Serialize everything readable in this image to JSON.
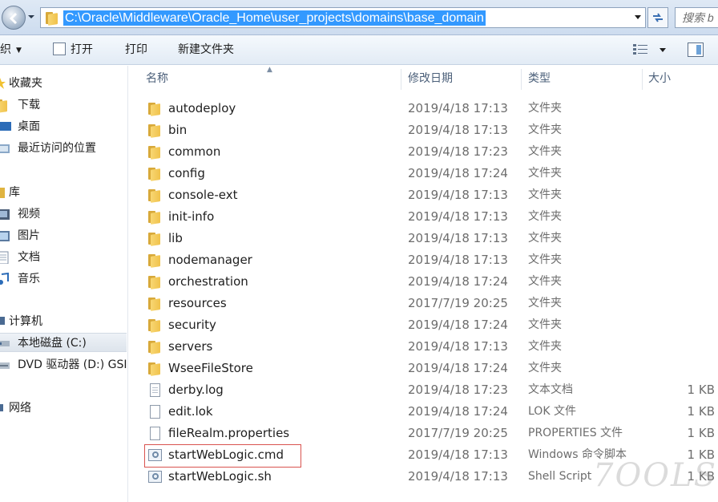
{
  "address_bar": {
    "path": "C:\\Oracle\\Middleware\\Oracle_Home\\user_projects\\domains\\base_domain",
    "search_placeholder": "搜索 b"
  },
  "toolbar": {
    "organize_label": "织",
    "open_label": "打开",
    "print_label": "打印",
    "new_folder_label": "新建文件夹"
  },
  "nav": {
    "favorites": "收藏夹",
    "downloads": "下载",
    "desktop": "桌面",
    "recent": "最近访问的位置",
    "libraries": "库",
    "videos": "视频",
    "pictures": "图片",
    "documents": "文档",
    "music": "音乐",
    "computer": "计算机",
    "local_disk": "本地磁盘 (C:)",
    "dvd": "DVD 驱动器 (D:) GSI",
    "network": "网络"
  },
  "columns": {
    "name": "名称",
    "date": "修改日期",
    "type": "类型",
    "size": "大小"
  },
  "files": [
    {
      "name": "autodeploy",
      "date": "2019/4/18 17:13",
      "type": "文件夹",
      "size": "",
      "icon": "folder-icon"
    },
    {
      "name": "bin",
      "date": "2019/4/18 17:13",
      "type": "文件夹",
      "size": "",
      "icon": "folder-icon"
    },
    {
      "name": "common",
      "date": "2019/4/18 17:23",
      "type": "文件夹",
      "size": "",
      "icon": "folder-icon"
    },
    {
      "name": "config",
      "date": "2019/4/18 17:24",
      "type": "文件夹",
      "size": "",
      "icon": "folder-icon"
    },
    {
      "name": "console-ext",
      "date": "2019/4/18 17:13",
      "type": "文件夹",
      "size": "",
      "icon": "folder-icon"
    },
    {
      "name": "init-info",
      "date": "2019/4/18 17:13",
      "type": "文件夹",
      "size": "",
      "icon": "folder-icon"
    },
    {
      "name": "lib",
      "date": "2019/4/18 17:13",
      "type": "文件夹",
      "size": "",
      "icon": "folder-icon"
    },
    {
      "name": "nodemanager",
      "date": "2019/4/18 17:13",
      "type": "文件夹",
      "size": "",
      "icon": "folder-icon"
    },
    {
      "name": "orchestration",
      "date": "2019/4/18 17:24",
      "type": "文件夹",
      "size": "",
      "icon": "folder-icon"
    },
    {
      "name": "resources",
      "date": "2017/7/19 20:25",
      "type": "文件夹",
      "size": "",
      "icon": "folder-icon"
    },
    {
      "name": "security",
      "date": "2019/4/18 17:24",
      "type": "文件夹",
      "size": "",
      "icon": "folder-icon"
    },
    {
      "name": "servers",
      "date": "2019/4/18 17:13",
      "type": "文件夹",
      "size": "",
      "icon": "folder-icon"
    },
    {
      "name": "WseeFileStore",
      "date": "2019/4/18 17:24",
      "type": "文件夹",
      "size": "",
      "icon": "folder-icon"
    },
    {
      "name": "derby.log",
      "date": "2019/4/18 17:23",
      "type": "文本文档",
      "size": "1 KB",
      "icon": "text-file-icon"
    },
    {
      "name": "edit.lok",
      "date": "2019/4/18 17:24",
      "type": "LOK 文件",
      "size": "1 KB",
      "icon": "file-icon"
    },
    {
      "name": "fileRealm.properties",
      "date": "2017/7/19 20:25",
      "type": "PROPERTIES 文件",
      "size": "1 KB",
      "icon": "file-icon"
    },
    {
      "name": "startWebLogic.cmd",
      "date": "2019/4/18 17:13",
      "type": "Windows 命令脚本",
      "size": "1 KB",
      "icon": "script-icon"
    },
    {
      "name": "startWebLogic.sh",
      "date": "2019/4/18 17:13",
      "type": "Shell Script",
      "size": "1 KB",
      "icon": "script-icon"
    }
  ],
  "watermark_text": "7OOLS",
  "colors": {
    "selection": "#3399ff",
    "highlight_box": "#d9534f",
    "folder": "#f0c24b"
  }
}
